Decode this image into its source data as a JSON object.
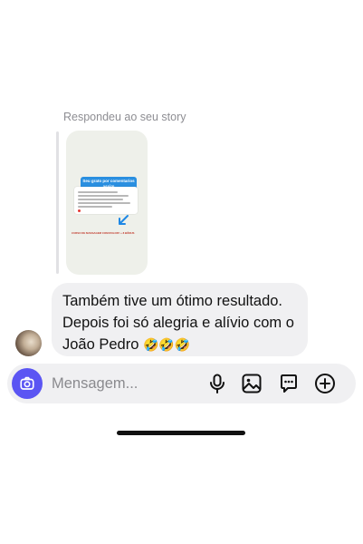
{
  "story_reply": {
    "label": "Respondeu ao seu story",
    "thumbnail": {
      "header": "Seu grato por comentarios assim",
      "footer": "CURSO DE MASSAGEM COM ROLOFF + 8 BÔNUS"
    }
  },
  "message": {
    "line1": "Também tive um ótimo resultado.",
    "line2": "Depois foi só alegria e alívio com o",
    "line3": "João Pedro",
    "emojis": "🤣🤣🤣"
  },
  "composer": {
    "placeholder": "Mensagem...",
    "icons": [
      "camera-icon",
      "microphone-icon",
      "gallery-icon",
      "sticker-icon",
      "plus-icon"
    ]
  },
  "colors": {
    "accent": "#5b55f3",
    "bubble": "#f0f0f2",
    "story_header": "#2a8fe0"
  }
}
